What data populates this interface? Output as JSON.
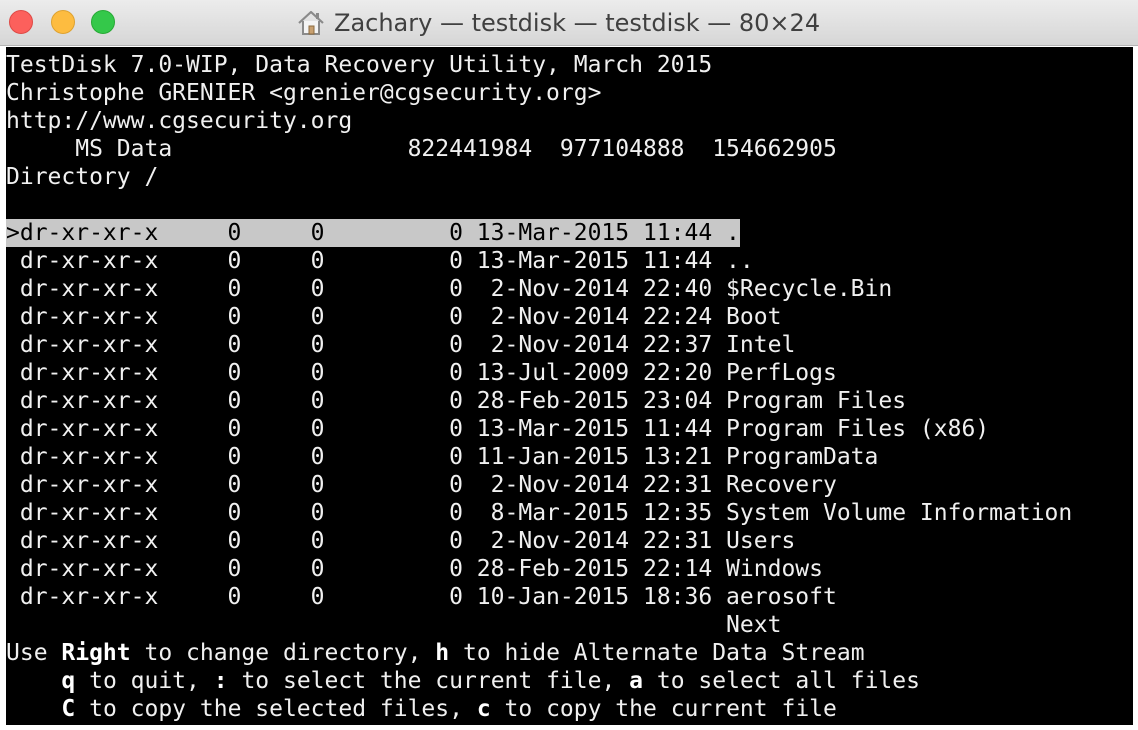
{
  "window": {
    "title": "Zachary — testdisk — testdisk — 80×24",
    "close_glyph": "×"
  },
  "terminal": {
    "header": [
      "TestDisk 7.0-WIP, Data Recovery Utility, March 2015",
      "Christophe GRENIER <grenier@cgsecurity.org>",
      "http://www.cgsecurity.org",
      "     MS Data                 822441984  977104888  154662905",
      "Directory /"
    ],
    "entries": [
      ">dr-xr-xr-x     0     0         0 13-Mar-2015 11:44 .",
      " dr-xr-xr-x     0     0         0 13-Mar-2015 11:44 ..",
      " dr-xr-xr-x     0     0         0  2-Nov-2014 22:40 $Recycle.Bin",
      " dr-xr-xr-x     0     0         0  2-Nov-2014 22:24 Boot",
      " dr-xr-xr-x     0     0         0  2-Nov-2014 22:37 Intel",
      " dr-xr-xr-x     0     0         0 13-Jul-2009 22:20 PerfLogs",
      " dr-xr-xr-x     0     0         0 28-Feb-2015 23:04 Program Files",
      " dr-xr-xr-x     0     0         0 13-Mar-2015 11:44 Program Files (x86)",
      " dr-xr-xr-x     0     0         0 11-Jan-2015 13:21 ProgramData",
      " dr-xr-xr-x     0     0         0  2-Nov-2014 22:31 Recovery",
      " dr-xr-xr-x     0     0         0  8-Mar-2015 12:35 System Volume Information",
      " dr-xr-xr-x     0     0         0  2-Nov-2014 22:31 Users",
      " dr-xr-xr-x     0     0         0 28-Feb-2015 22:14 Windows",
      " dr-xr-xr-x     0     0         0 10-Jan-2015 18:36 aerosoft"
    ],
    "next_label": "                                                    Next",
    "help": {
      "l1_a": "Use ",
      "l1_key1": "Right",
      "l1_b": " to change directory, ",
      "l1_key2": "h",
      "l1_c": " to hide Alternate Data Stream",
      "l2_a": "    ",
      "l2_key1": "q",
      "l2_b": " to quit, ",
      "l2_key2": ":",
      "l2_c": " to select the current file, ",
      "l2_key3": "a",
      "l2_d": " to select all files",
      "l3_a": "    ",
      "l3_key1": "C",
      "l3_b": " to copy the selected files, ",
      "l3_key2": "c",
      "l3_c": " to copy the current file"
    }
  }
}
